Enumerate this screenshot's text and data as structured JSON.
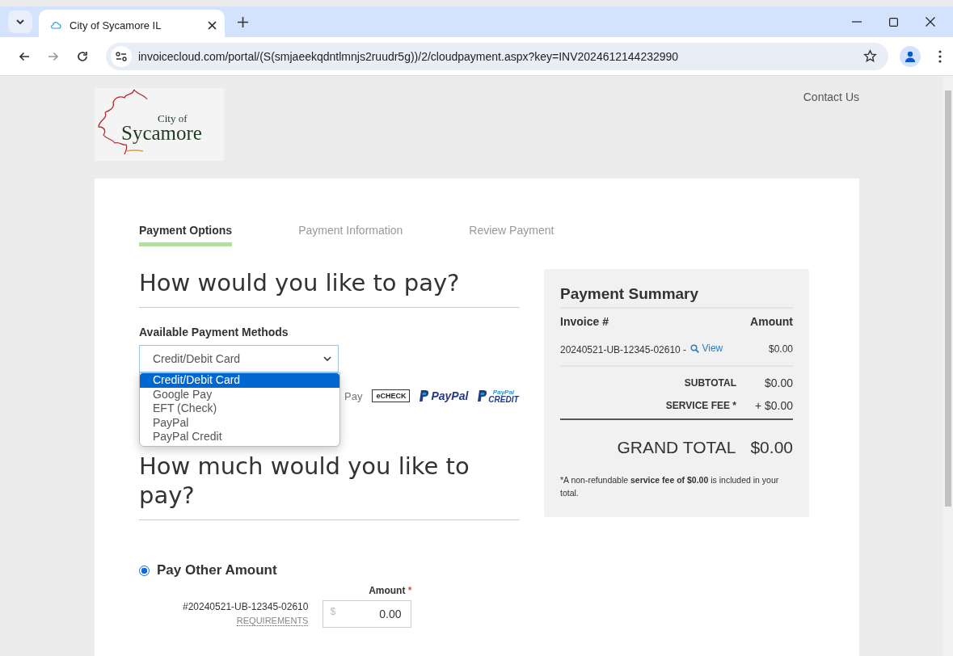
{
  "browser": {
    "tab_title": "City of Sycamore IL",
    "url": "invoicecloud.com/portal/(S(smjaeekqdntlmnjs2ruudr5g))/2/cloudpayment.aspx?key=INV2024612144232990"
  },
  "header": {
    "logo_small": "City of",
    "logo_large": "Sycamore",
    "contact_link": "Contact Us"
  },
  "steps": [
    {
      "label": "Payment Options",
      "selected": true
    },
    {
      "label": "Payment Information",
      "selected": false
    },
    {
      "label": "Review Payment",
      "selected": false
    }
  ],
  "payment_section": {
    "heading": "How would you like to pay?",
    "label": "Available Payment Methods",
    "select_value": "Credit/Debit Card",
    "options": [
      {
        "label": "Credit/Debit Card",
        "selected": true
      },
      {
        "label": "Google Pay",
        "selected": false
      },
      {
        "label": "EFT (Check)",
        "selected": false
      },
      {
        "label": "PayPal",
        "selected": false
      },
      {
        "label": "PayPal Credit",
        "selected": false
      }
    ],
    "logos": {
      "google_pay_visible": "Pay",
      "echeck": "eCHECK",
      "paypal": "PayPal",
      "paypal_credit_small": "PayPal",
      "paypal_credit": "CREDIT"
    }
  },
  "amount_section": {
    "heading": "How much would you like to pay?",
    "option_label": "Pay Other Amount",
    "option_selected": true,
    "invoice": "#20240521-UB-12345-02610",
    "requirements_link": "REQUIREMENTS",
    "amount_label": "Amount",
    "required_mark": "*",
    "currency": "$",
    "amount_value": "0.00"
  },
  "summary": {
    "title": "Payment Summary",
    "col_invoice": "Invoice #",
    "col_amount": "Amount",
    "invoice_number": "20240521-UB-12345-02610 -",
    "view_link": "View",
    "invoice_amount": "$0.00",
    "subtotal_label": "SUBTOTAL",
    "subtotal": "$0.00",
    "fee_label": "SERVICE FEE *",
    "fee": "+ $0.00",
    "grand_label": "GRAND TOTAL",
    "grand_total": "$0.00",
    "note": "*A non-refundable **service fee of $0.00** is included in your total."
  }
}
